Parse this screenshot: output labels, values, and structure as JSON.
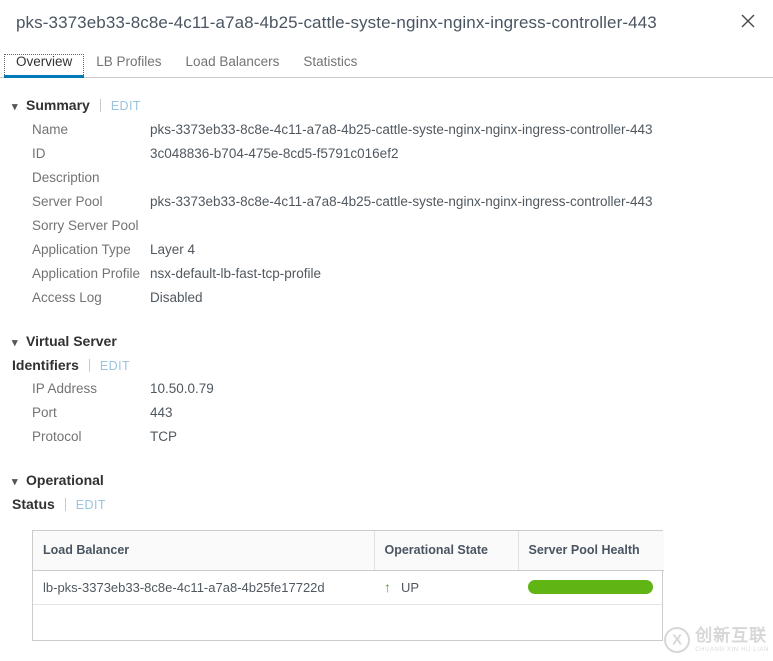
{
  "window": {
    "title": "pks-3373eb33-8c8e-4c11-a7a8-4b25-cattle-syste-nginx-nginx-ingress-controller-443",
    "close_icon": "close-icon"
  },
  "tabs": [
    {
      "label": "Overview",
      "active": true
    },
    {
      "label": "LB Profiles",
      "active": false
    },
    {
      "label": "Load Balancers",
      "active": false
    },
    {
      "label": "Statistics",
      "active": false
    }
  ],
  "sections": {
    "summary": {
      "title": "Summary",
      "edit_label": "EDIT",
      "caret_icon": "chevron-down-icon",
      "rows": [
        {
          "label": "Name",
          "value": "pks-3373eb33-8c8e-4c11-a7a8-4b25-cattle-syste-nginx-nginx-ingress-controller-443"
        },
        {
          "label": "ID",
          "value": "3c048836-b704-475e-8cd5-f5791c016ef2"
        },
        {
          "label": "Description",
          "value": ""
        },
        {
          "label": "Server Pool",
          "value": "pks-3373eb33-8c8e-4c11-a7a8-4b25-cattle-syste-nginx-nginx-ingress-controller-443"
        },
        {
          "label": "Sorry Server Pool",
          "value": ""
        },
        {
          "label": "Application Type",
          "value": "Layer 4"
        },
        {
          "label": "Application Profile",
          "value": "nsx-default-lb-fast-tcp-profile"
        },
        {
          "label": "Access Log",
          "value": "Disabled"
        }
      ]
    },
    "virtual_server_identifiers": {
      "title_line1": "Virtual Server",
      "title_line2": "Identifiers",
      "edit_label": "EDIT",
      "caret_icon": "chevron-down-icon",
      "rows": [
        {
          "label": "IP Address",
          "value": "10.50.0.79"
        },
        {
          "label": "Port",
          "value": "443"
        },
        {
          "label": "Protocol",
          "value": "TCP"
        }
      ]
    },
    "operational_status": {
      "title_line1": "Operational",
      "title_line2": "Status",
      "edit_label": "EDIT",
      "caret_icon": "chevron-down-icon",
      "table": {
        "columns": [
          "Load Balancer",
          "Operational State",
          "Server Pool Health"
        ],
        "rows": [
          {
            "load_balancer": "lb-pks-3373eb33-8c8e-4c11-a7a8-4b25fe17722d",
            "operational_state": "UP",
            "state_icon": "arrow-up-icon",
            "server_pool_health_percent": 100
          }
        ]
      }
    }
  },
  "watermark": {
    "chinese": "创新互联",
    "pinyin": "CHUANG XIN HU LIAN",
    "mark_icon": "circled-x-logo-icon"
  },
  "colors": {
    "accent": "#0079b8",
    "edit_link": "#9ac4e0",
    "health_green": "#60b515",
    "up_green": "#62a420",
    "label_grey": "#737373",
    "value_grey": "#50585f"
  }
}
